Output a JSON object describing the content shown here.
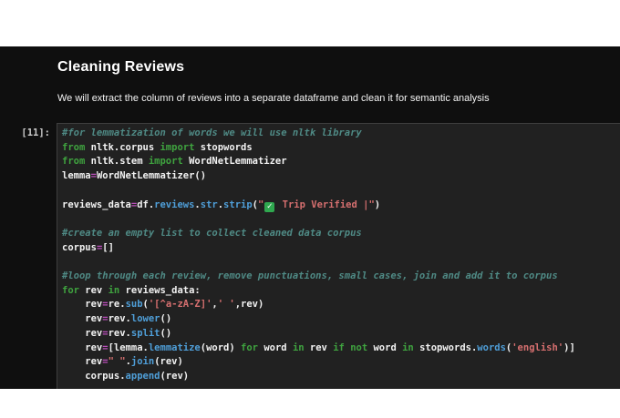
{
  "markdown": {
    "title": "Cleaning Reviews",
    "subtitle": "We will extract the column of reviews into a separate dataframe and clean it for semantic analysis"
  },
  "cell": {
    "prompt": "[11]:",
    "lines": [
      [
        [
          "com",
          "#for lemmatization of words we will use nltk library"
        ]
      ],
      [
        [
          "kw",
          "from"
        ],
        [
          "txt",
          " nltk.corpus "
        ],
        [
          "kw",
          "import"
        ],
        [
          "txt",
          " stopwords"
        ]
      ],
      [
        [
          "kw",
          "from"
        ],
        [
          "txt",
          " nltk.stem "
        ],
        [
          "kw",
          "import"
        ],
        [
          "txt",
          " WordNetLemmatizer"
        ]
      ],
      [
        [
          "txt",
          "lemma"
        ],
        [
          "op",
          "="
        ],
        [
          "txt",
          "WordNetLemmatizer()"
        ]
      ],
      [],
      [
        [
          "txt",
          "reviews_data"
        ],
        [
          "op",
          "="
        ],
        [
          "txt",
          "df."
        ],
        [
          "meth",
          "reviews"
        ],
        [
          "txt",
          "."
        ],
        [
          "meth",
          "str"
        ],
        [
          "txt",
          "."
        ],
        [
          "meth",
          "strip"
        ],
        [
          "txt",
          "("
        ],
        [
          "str",
          "\""
        ],
        [
          "emoji",
          "✓"
        ],
        [
          "str",
          " Trip Verified |\""
        ],
        [
          "txt",
          ")"
        ]
      ],
      [],
      [
        [
          "com",
          "#create an empty list to collect cleaned data corpus"
        ]
      ],
      [
        [
          "txt",
          "corpus"
        ],
        [
          "op",
          "="
        ],
        [
          "txt",
          "[]"
        ]
      ],
      [],
      [
        [
          "com",
          "#loop through each review, remove punctuations, small cases, join and add it to corpus"
        ]
      ],
      [
        [
          "kw",
          "for"
        ],
        [
          "txt",
          " rev "
        ],
        [
          "kw",
          "in"
        ],
        [
          "txt",
          " reviews_data:"
        ]
      ],
      [
        [
          "txt",
          "    rev"
        ],
        [
          "op",
          "="
        ],
        [
          "txt",
          "re."
        ],
        [
          "meth",
          "sub"
        ],
        [
          "txt",
          "("
        ],
        [
          "str",
          "'[^a-zA-Z]'"
        ],
        [
          "txt",
          ","
        ],
        [
          "str",
          "' '"
        ],
        [
          "txt",
          ",rev)"
        ]
      ],
      [
        [
          "txt",
          "    rev"
        ],
        [
          "op",
          "="
        ],
        [
          "txt",
          "rev."
        ],
        [
          "meth",
          "lower"
        ],
        [
          "txt",
          "()"
        ]
      ],
      [
        [
          "txt",
          "    rev"
        ],
        [
          "op",
          "="
        ],
        [
          "txt",
          "rev."
        ],
        [
          "meth",
          "split"
        ],
        [
          "txt",
          "()"
        ]
      ],
      [
        [
          "txt",
          "    rev"
        ],
        [
          "op",
          "="
        ],
        [
          "txt",
          "[lemma."
        ],
        [
          "meth",
          "lemmatize"
        ],
        [
          "txt",
          "(word) "
        ],
        [
          "kw",
          "for"
        ],
        [
          "txt",
          " word "
        ],
        [
          "kw",
          "in"
        ],
        [
          "txt",
          " rev "
        ],
        [
          "kw",
          "if"
        ],
        [
          "txt",
          " "
        ],
        [
          "kw",
          "not"
        ],
        [
          "txt",
          " word "
        ],
        [
          "kw",
          "in"
        ],
        [
          "txt",
          " stopwords."
        ],
        [
          "meth",
          "words"
        ],
        [
          "txt",
          "("
        ],
        [
          "str",
          "'english'"
        ],
        [
          "txt",
          ")]"
        ]
      ],
      [
        [
          "txt",
          "    rev"
        ],
        [
          "op",
          "="
        ],
        [
          "str",
          "\" \""
        ],
        [
          "txt",
          "."
        ],
        [
          "meth",
          "join"
        ],
        [
          "txt",
          "(rev)"
        ]
      ],
      [
        [
          "txt",
          "    corpus."
        ],
        [
          "meth",
          "append"
        ],
        [
          "txt",
          "(rev)"
        ]
      ]
    ]
  },
  "colors": {
    "page_background": "#0f0f0f",
    "cell_background": "#212121",
    "cell_border": "#3e3e3e",
    "text": "#f2f2f2",
    "keyword_green": "#3fa33f",
    "method_blue": "#4f9fd9",
    "string_red": "#d66f6f",
    "operator_magenta": "#bb4fbb",
    "comment_teal": "#4f8a85",
    "emoji_green": "#2fa84f"
  }
}
